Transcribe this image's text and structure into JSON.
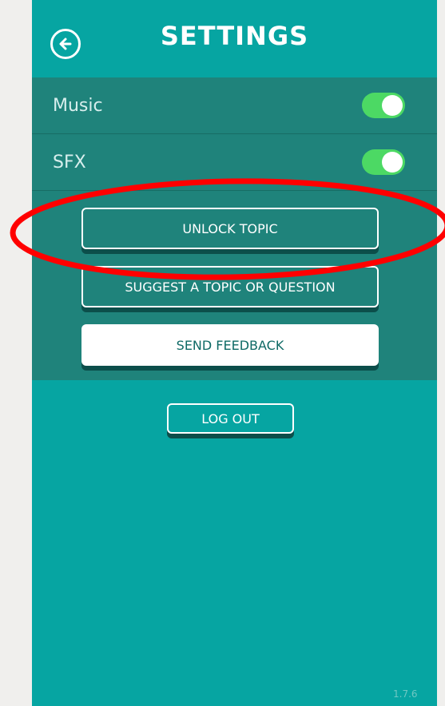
{
  "header": {
    "title": "SETTINGS"
  },
  "settings": {
    "music_label": "Music",
    "sfx_label": "SFX",
    "music_on": true,
    "sfx_on": true
  },
  "buttons": {
    "unlock_topic": "UNLOCK TOPIC",
    "suggest_topic": "SUGGEST A TOPIC OR QUESTION",
    "send_feedback": "SEND FEEDBACK",
    "log_out": "LOG OUT"
  },
  "footer": {
    "version": "1.7.6"
  },
  "colors": {
    "background": "#06a5a2",
    "panel": "#1f837b",
    "toggle_on": "#4cd964",
    "annotation": "#ff0000"
  },
  "icons": {
    "back": "back-arrow-circle-icon"
  }
}
